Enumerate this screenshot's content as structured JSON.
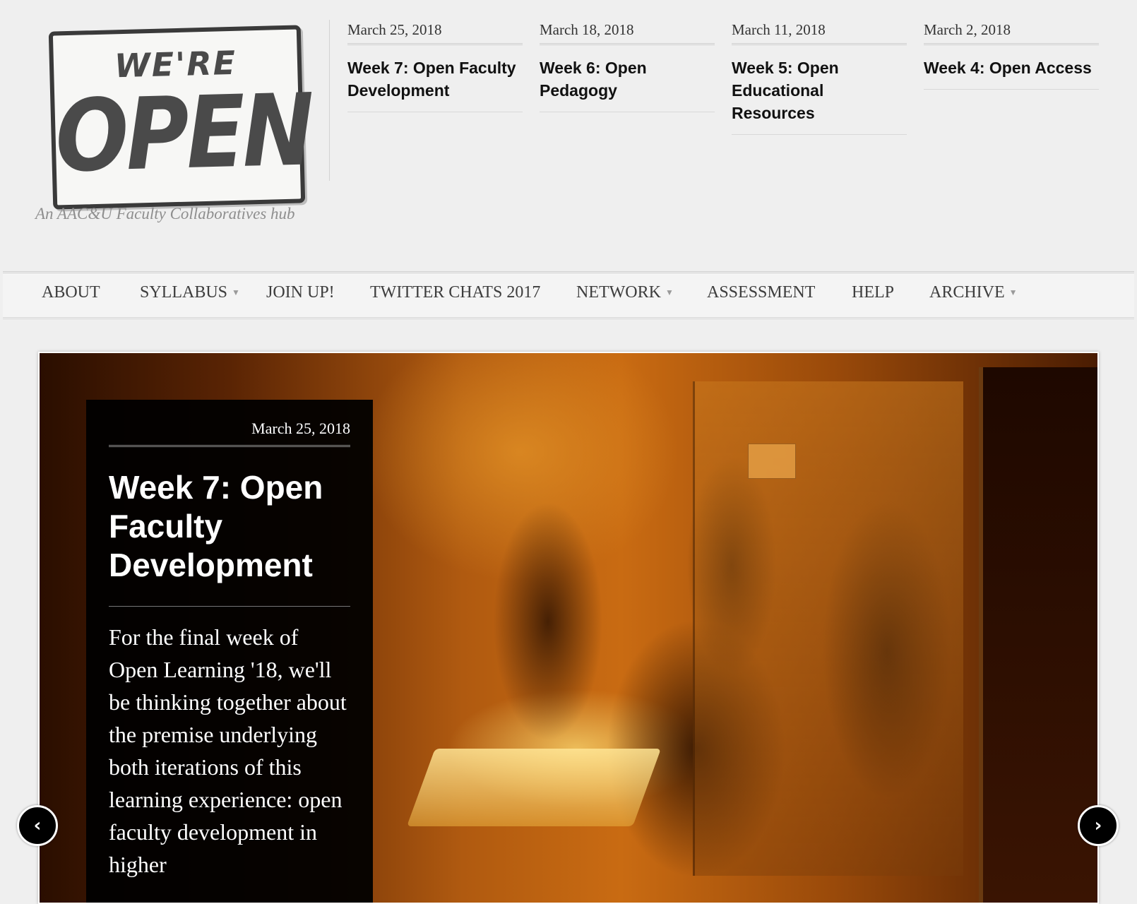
{
  "logo": {
    "sign_top": "WE'RE",
    "sign_main": "OPEN",
    "tagline": "An AAC&U Faculty Collaboratives hub"
  },
  "recent_posts": [
    {
      "date": "March 25, 2018",
      "title": "Week 7: Open Faculty Development"
    },
    {
      "date": "March 18, 2018",
      "title": "Week 6: Open Pedagogy"
    },
    {
      "date": "March 11, 2018",
      "title": "Week 5: Open Educational Resources"
    },
    {
      "date": "March 2, 2018",
      "title": "Week 4: Open Access"
    }
  ],
  "nav": {
    "about": "ABOUT",
    "syllabus": "SYLLABUS",
    "join_up": "JOIN UP!",
    "twitter_chats": "TWITTER CHATS 2017",
    "network": "NETWORK",
    "assessment": "ASSESSMENT",
    "help": "HELP",
    "archive": "ARCHIVE",
    "caret": "▼"
  },
  "featured": {
    "date": "March 25, 2018",
    "title": "Week 7: Open Faculty Development",
    "excerpt": "For the final week of Open Learning '18, we'll be thinking together about the premise underlying both iterations of this learning experience: open faculty development in higher"
  },
  "slider_controls": {
    "prev": "‹",
    "next": "›"
  }
}
